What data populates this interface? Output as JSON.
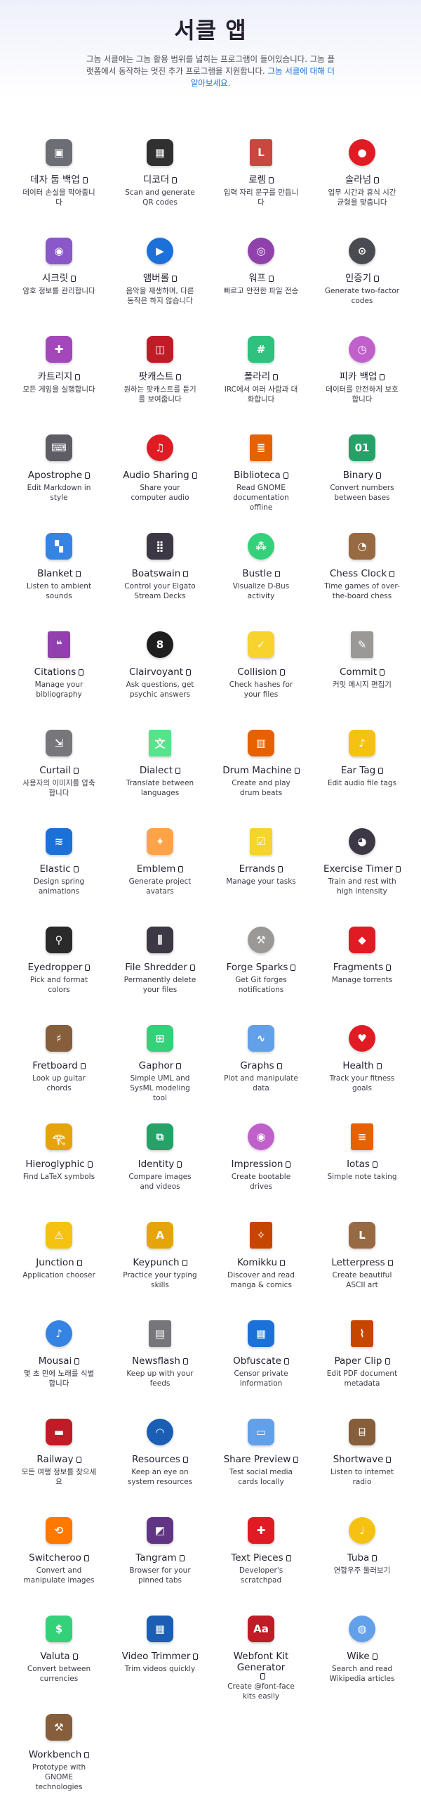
{
  "header": {
    "title": "서클 앱",
    "intro": "그놈 서클에는 그놈 활용 범위를 넓히는 프로그램이 들어있습니다. 그놈 플랫폼에서 동작하는 멋진 추가 프로그램을 지원합니다. ",
    "intro_link": "그놈 서클에 대해 더 알아보세요."
  },
  "colors": {
    "accent": "#1c71d8",
    "text": "#241f31",
    "muted": "#3d3846"
  },
  "apps": [
    {
      "name": "데자 둡 백업",
      "desc": "데이터 손실을 막아줍니다",
      "icon": "safe-icon",
      "color": "#6d6d75",
      "shape": "sq",
      "glyph": "▣"
    },
    {
      "name": "디코더",
      "desc": "Scan and generate QR codes",
      "icon": "qr-code-icon",
      "color": "#303030",
      "shape": "sq",
      "glyph": "▦"
    },
    {
      "name": "로렘",
      "desc": "입력 자리 문구를 만듭니다",
      "icon": "document-icon",
      "color": "#c8473e",
      "shape": "doc",
      "glyph": "L"
    },
    {
      "name": "솔라넘",
      "desc": "업무 시간과 휴식 시간 균형을 맞춥니다",
      "icon": "tomato-icon",
      "color": "#e01b24",
      "shape": "rd",
      "glyph": "●"
    },
    {
      "name": "시크릿",
      "desc": "암호 정보를 관리합니다",
      "icon": "password-safe-icon",
      "color": "#8a58c8",
      "shape": "sq",
      "glyph": "◉"
    },
    {
      "name": "앰버롤",
      "desc": "음악을 재생하며, 다른 동작은 하지 않습니다",
      "icon": "music-player-icon",
      "color": "#1c71d8",
      "shape": "rd",
      "glyph": "▶"
    },
    {
      "name": "워프",
      "desc": "빠르고 안전한 파일 전송",
      "icon": "wormhole-icon",
      "color": "#9141ac",
      "shape": "rd",
      "glyph": "◎"
    },
    {
      "name": "인증기",
      "desc": "Generate two-factor codes",
      "icon": "padlock-icon",
      "color": "#4a4a52",
      "shape": "rd",
      "glyph": "⊙"
    },
    {
      "name": "카트리지",
      "desc": "모든 게임을 실행합니다",
      "icon": "gamepad-icon",
      "color": "#a347ba",
      "shape": "sq",
      "glyph": "✚"
    },
    {
      "name": "팟캐스트",
      "desc": "원하는 팟캐스트를 듣기를 보여줍니다",
      "icon": "cassette-icon",
      "color": "#c01c28",
      "shape": "sq",
      "glyph": "◫"
    },
    {
      "name": "폴라리",
      "desc": "IRC에서 여러 사람과 대화합니다",
      "icon": "chat-hash-icon",
      "color": "#2ec27e",
      "shape": "sq",
      "glyph": "#"
    },
    {
      "name": "피카 백업",
      "desc": "데이터를 안전하게 보호합니다",
      "icon": "backup-clock-icon",
      "color": "#c061cb",
      "shape": "rd",
      "glyph": "◷"
    },
    {
      "name": "Apostrophe",
      "desc": "Edit Markdown in style",
      "icon": "typewriter-icon",
      "color": "#5e5c64",
      "shape": "sq",
      "glyph": "⌨"
    },
    {
      "name": "Audio Sharing",
      "desc": "Share your computer audio",
      "icon": "headphones-icon",
      "color": "#e01b24",
      "shape": "rd",
      "glyph": "♫"
    },
    {
      "name": "Biblioteca",
      "desc": "Read GNOME documentation offline",
      "icon": "book-icon",
      "color": "#e66100",
      "shape": "doc",
      "glyph": "≣"
    },
    {
      "name": "Binary",
      "desc": "Convert numbers between bases",
      "icon": "binary-display-icon",
      "color": "#26a269",
      "shape": "sq",
      "glyph": "01"
    },
    {
      "name": "Blanket",
      "desc": "Listen to ambient sounds",
      "icon": "blanket-icon",
      "color": "#3584e4",
      "shape": "sq",
      "glyph": "▚"
    },
    {
      "name": "Boatswain",
      "desc": "Control your Elgato Stream Decks",
      "icon": "stream-deck-icon",
      "color": "#3d3846",
      "shape": "sq",
      "glyph": "⣿"
    },
    {
      "name": "Bustle",
      "desc": "Visualize D-Bus activity",
      "icon": "bus-graph-icon",
      "color": "#33d17a",
      "shape": "rd",
      "glyph": "⁂"
    },
    {
      "name": "Chess Clock",
      "desc": "Time games of over-the-board chess",
      "icon": "chess-clock-icon",
      "color": "#986a44",
      "shape": "sq",
      "glyph": "◔"
    },
    {
      "name": "Citations",
      "desc": "Manage your bibliography",
      "icon": "citations-icon",
      "color": "#9141ac",
      "shape": "doc",
      "glyph": "❝"
    },
    {
      "name": "Clairvoyant",
      "desc": "Ask questions, get psychic answers",
      "icon": "magic-8-ball-icon",
      "color": "#1e1e1e",
      "shape": "rd",
      "glyph": "8"
    },
    {
      "name": "Collision",
      "desc": "Check hashes for your files",
      "icon": "hash-check-icon",
      "color": "#f6d32d",
      "shape": "sq",
      "glyph": "✓"
    },
    {
      "name": "Commit",
      "desc": "커밋 메시지 편집기",
      "icon": "commit-icon",
      "color": "#9a9996",
      "shape": "doc",
      "glyph": "✎"
    },
    {
      "name": "Curtail",
      "desc": "사용자의 이미지를 압축합니다",
      "icon": "compress-image-icon",
      "color": "#77767b",
      "shape": "sq",
      "glyph": "⇲"
    },
    {
      "name": "Dialect",
      "desc": "Translate between languages",
      "icon": "translate-icon",
      "color": "#57e389",
      "shape": "doc",
      "glyph": "文"
    },
    {
      "name": "Drum Machine",
      "desc": "Create and play drum beats",
      "icon": "drum-machine-icon",
      "color": "#e66100",
      "shape": "sq",
      "glyph": "▥"
    },
    {
      "name": "Ear Tag",
      "desc": "Edit audio file tags",
      "icon": "ear-tag-icon",
      "color": "#f5c211",
      "shape": "sq",
      "glyph": "♪"
    },
    {
      "name": "Elastic",
      "desc": "Design spring animations",
      "icon": "spring-icon",
      "color": "#1c71d8",
      "shape": "sq",
      "glyph": "≋"
    },
    {
      "name": "Emblem",
      "desc": "Generate project avatars",
      "icon": "emblem-icon",
      "color": "#ffa348",
      "shape": "sq",
      "glyph": "✦"
    },
    {
      "name": "Errands",
      "desc": "Manage your tasks",
      "icon": "task-list-icon",
      "color": "#f6d32d",
      "shape": "doc",
      "glyph": "☑"
    },
    {
      "name": "Exercise Timer",
      "desc": "Train and rest with high intensity",
      "icon": "timer-icon",
      "color": "#3d3846",
      "shape": "rd",
      "glyph": "◕"
    },
    {
      "name": "Eyedropper",
      "desc": "Pick and format colors",
      "icon": "eyedropper-icon",
      "color": "#2a2a2a",
      "shape": "sq",
      "glyph": "⚲"
    },
    {
      "name": "File Shredder",
      "desc": "Permanently delete your files",
      "icon": "shredder-icon",
      "color": "#3d3846",
      "shape": "sq",
      "glyph": "⫼"
    },
    {
      "name": "Forge Sparks",
      "desc": "Get Git forges notifications",
      "icon": "forge-sparks-icon",
      "color": "#9a9996",
      "shape": "rd",
      "glyph": "⚒"
    },
    {
      "name": "Fragments",
      "desc": "Manage torrents",
      "icon": "fragments-icon",
      "color": "#e01b24",
      "shape": "sq",
      "glyph": "◆"
    },
    {
      "name": "Fretboard",
      "desc": "Look up guitar chords",
      "icon": "fretboard-icon",
      "color": "#865e3c",
      "shape": "sq",
      "glyph": "♯"
    },
    {
      "name": "Gaphor",
      "desc": "Simple UML and SysML modeling tool",
      "icon": "uml-diagram-icon",
      "color": "#33d17a",
      "shape": "sq",
      "glyph": "⊞"
    },
    {
      "name": "Graphs",
      "desc": "Plot and manipulate data",
      "icon": "graph-plot-icon",
      "color": "#62a0ea",
      "shape": "sq",
      "glyph": "∿"
    },
    {
      "name": "Health",
      "desc": "Track your fitness goals",
      "icon": "heart-pulse-icon",
      "color": "#e01b24",
      "shape": "rd",
      "glyph": "♥"
    },
    {
      "name": "Hieroglyphic",
      "desc": "Find LaTeX symbols",
      "icon": "hieroglyph-icon",
      "color": "#e5a50a",
      "shape": "sq",
      "glyph": "𓂀"
    },
    {
      "name": "Identity",
      "desc": "Compare images and videos",
      "icon": "identity-icon",
      "color": "#26a269",
      "shape": "sq",
      "glyph": "⧉"
    },
    {
      "name": "Impression",
      "desc": "Create bootable drives",
      "icon": "disc-icon",
      "color": "#c061cb",
      "shape": "rd",
      "glyph": "◉"
    },
    {
      "name": "Iotas",
      "desc": "Simple note taking",
      "icon": "notebook-icon",
      "color": "#e66100",
      "shape": "doc",
      "glyph": "≡"
    },
    {
      "name": "Junction",
      "desc": "Application chooser",
      "icon": "junction-sign-icon",
      "color": "#f5c211",
      "shape": "sq",
      "glyph": "⚠"
    },
    {
      "name": "Keypunch",
      "desc": "Practice your typing skills",
      "icon": "keypunch-icon",
      "color": "#e5a50a",
      "shape": "sq",
      "glyph": "A"
    },
    {
      "name": "Komikku",
      "desc": "Discover and read manga & comics",
      "icon": "comic-book-icon",
      "color": "#c64600",
      "shape": "doc",
      "glyph": "✧"
    },
    {
      "name": "Letterpress",
      "desc": "Create beautiful ASCII art",
      "icon": "letterpress-icon",
      "color": "#986a44",
      "shape": "sq",
      "glyph": "L"
    },
    {
      "name": "Mousai",
      "desc": "몇 초 만에 노래를 식별합니다",
      "icon": "music-note-icon",
      "color": "#3584e4",
      "shape": "rd",
      "glyph": "♪"
    },
    {
      "name": "Newsflash",
      "desc": "Keep up with your feeds",
      "icon": "newspaper-icon",
      "color": "#77767b",
      "shape": "doc",
      "glyph": "▤"
    },
    {
      "name": "Obfuscate",
      "desc": "Censor private information",
      "icon": "obfuscate-icon",
      "color": "#1c71d8",
      "shape": "sq",
      "glyph": "▦"
    },
    {
      "name": "Paper Clip",
      "desc": "Edit PDF document metadata",
      "icon": "paper-clip-icon",
      "color": "#c64600",
      "shape": "doc",
      "glyph": "⌇"
    },
    {
      "name": "Railway",
      "desc": "모든 여행 정보를 찾으세요",
      "icon": "train-icon",
      "color": "#c01c28",
      "shape": "sq",
      "glyph": "▬"
    },
    {
      "name": "Resources",
      "desc": "Keep an eye on system resources",
      "icon": "gauge-icon",
      "color": "#1a5fb4",
      "shape": "rd",
      "glyph": "◠"
    },
    {
      "name": "Share Preview",
      "desc": "Test social media cards locally",
      "icon": "share-preview-icon",
      "color": "#62a0ea",
      "shape": "sq",
      "glyph": "▭"
    },
    {
      "name": "Shortwave",
      "desc": "Listen to internet radio",
      "icon": "radio-icon",
      "color": "#865e3c",
      "shape": "sq",
      "glyph": "⌸"
    },
    {
      "name": "Switcheroo",
      "desc": "Convert and manipulate images",
      "icon": "image-convert-icon",
      "color": "#ff7800",
      "shape": "sq",
      "glyph": "⟲"
    },
    {
      "name": "Tangram",
      "desc": "Browser for your pinned tabs",
      "icon": "tangram-icon",
      "color": "#613583",
      "shape": "sq",
      "glyph": "◩"
    },
    {
      "name": "Text Pieces",
      "desc": "Developer's scratchpad",
      "icon": "swiss-knife-icon",
      "color": "#e01b24",
      "shape": "sq",
      "glyph": "✚"
    },
    {
      "name": "Tuba",
      "desc": "연합우주 둘러보기",
      "icon": "tuba-icon",
      "color": "#f5c211",
      "shape": "rd",
      "glyph": "♩"
    },
    {
      "name": "Valuta",
      "desc": "Convert between currencies",
      "icon": "currency-icon",
      "color": "#33d17a",
      "shape": "sq",
      "glyph": "$"
    },
    {
      "name": "Video Trimmer",
      "desc": "Trim videos quickly",
      "icon": "film-icon",
      "color": "#1a5fb4",
      "shape": "sq",
      "glyph": "▦"
    },
    {
      "name": "Webfont Kit Generator",
      "desc": "Create @font-face kits easily",
      "icon": "font-kit-icon",
      "color": "#c01c28",
      "shape": "sq",
      "glyph": "Aa"
    },
    {
      "name": "Wike",
      "desc": "Search and read Wikipedia articles",
      "icon": "globe-book-icon",
      "color": "#62a0ea",
      "shape": "rd",
      "glyph": "◍"
    },
    {
      "name": "Workbench",
      "desc": "Prototype with GNOME technologies",
      "icon": "toolbox-icon",
      "color": "#865e3c",
      "shape": "sq",
      "glyph": "⚒"
    }
  ]
}
